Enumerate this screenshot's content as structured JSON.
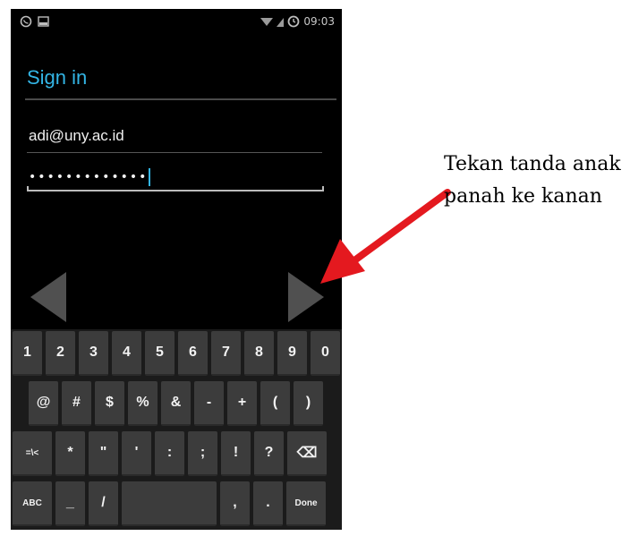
{
  "status_bar": {
    "time": "09:03",
    "icons": [
      "whatsapp-icon",
      "image-icon",
      "wifi-icon",
      "signal-icon",
      "clock-icon"
    ]
  },
  "signin": {
    "title": "Sign in",
    "email_value": "adi@uny.ac.id",
    "password_value": "•••••••••••••"
  },
  "keyboard": {
    "row1": [
      "1",
      "2",
      "3",
      "4",
      "5",
      "6",
      "7",
      "8",
      "9",
      "0"
    ],
    "row2": [
      "@",
      "#",
      "$",
      "%",
      "&",
      "-",
      "+",
      "(",
      ")"
    ],
    "row3": [
      "=\\<",
      "*",
      "\"",
      "'",
      ":",
      ";",
      "!",
      "?",
      "⌫"
    ],
    "row4": [
      "ABC",
      "_",
      "/",
      "",
      ",",
      ".",
      "Done"
    ]
  },
  "annotation": {
    "text": "Tekan tanda anak panah ke kanan",
    "arrow_color": "#e4191f"
  },
  "colors": {
    "accent": "#33b5e5",
    "background": "#000000"
  }
}
